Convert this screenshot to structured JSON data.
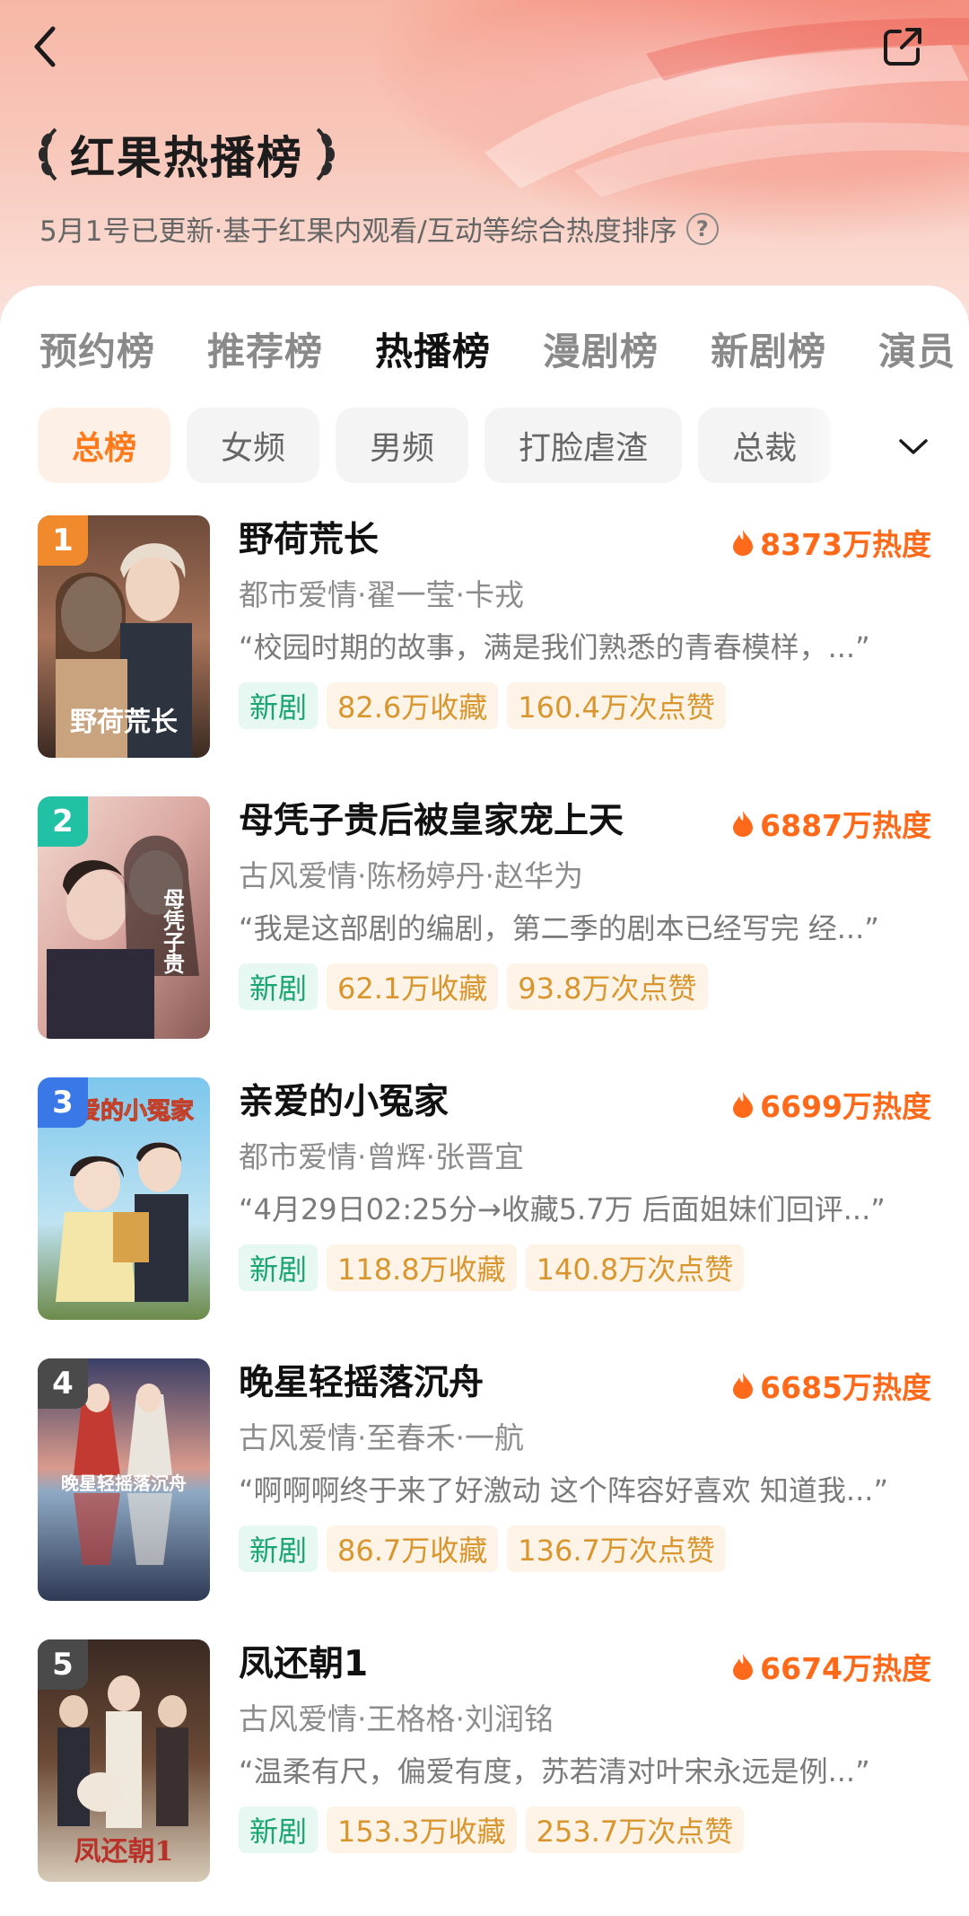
{
  "header": {
    "title": "红果热播榜",
    "subtitle": "5月1号已更新·基于红果内观看/互动等综合热度排序",
    "help_glyph": "?"
  },
  "tabs": [
    {
      "label": "预约榜",
      "active": false
    },
    {
      "label": "推荐榜",
      "active": false
    },
    {
      "label": "热播榜",
      "active": true
    },
    {
      "label": "漫剧榜",
      "active": false
    },
    {
      "label": "新剧榜",
      "active": false
    },
    {
      "label": "演员",
      "active": false
    }
  ],
  "chips": [
    {
      "label": "总榜",
      "active": true
    },
    {
      "label": "女频",
      "active": false
    },
    {
      "label": "男频",
      "active": false
    },
    {
      "label": "打脸虐渣",
      "active": false
    },
    {
      "label": "总裁",
      "active": false
    }
  ],
  "colors": {
    "accent": "#ff7a1a",
    "heat": "#ff6a1a",
    "new_badge_text": "#1aa571",
    "stat_badge_text": "#d9962f",
    "rank1": "#f08a2c",
    "rank2": "#21c1a6",
    "rank3": "#3b78e7",
    "rank_other": "#4a4a4a"
  },
  "items": [
    {
      "rank": "1",
      "title": "野荷荒长",
      "heat": "8373万热度",
      "tags": "都市爱情·翟一莹·卡戎",
      "quote": "“校园时期的故事，满是我们熟悉的青春模样，...”",
      "badge_new": "新剧",
      "favorites": "82.6万收藏",
      "likes": "160.4万次点赞",
      "poster_overlay": "野荷荒长"
    },
    {
      "rank": "2",
      "title": "母凭子贵后被皇家宠上天",
      "heat": "6887万热度",
      "tags": "古风爱情·陈杨婷丹·赵华为",
      "quote": "“我是这部剧的编剧，第二季的剧本已经写完 经...”",
      "badge_new": "新剧",
      "favorites": "62.1万收藏",
      "likes": "93.8万次点赞",
      "poster_overlay": "母凭子贵"
    },
    {
      "rank": "3",
      "title": "亲爱的小冤家",
      "heat": "6699万热度",
      "tags": "都市爱情·曾辉·张晋宜",
      "quote": "“4月29日02:25分→收藏5.7万 后面姐妹们回评...”",
      "badge_new": "新剧",
      "favorites": "118.8万收藏",
      "likes": "140.8万次点赞",
      "poster_overlay": "亲爱的小冤家"
    },
    {
      "rank": "4",
      "title": "晚星轻摇落沉舟",
      "heat": "6685万热度",
      "tags": "古风爱情·至春禾·一航",
      "quote": "“啊啊啊终于来了好激动 这个阵容好喜欢 知道我...”",
      "badge_new": "新剧",
      "favorites": "86.7万收藏",
      "likes": "136.7万次点赞",
      "poster_overlay": "晚星轻摇落沉舟"
    },
    {
      "rank": "5",
      "title": "凤还朝1",
      "heat": "6674万热度",
      "tags": "古风爱情·王格格·刘润铭",
      "quote": "“温柔有尺，偏爱有度，苏若清对叶宋永远是例...”",
      "badge_new": "新剧",
      "favorites": "153.3万收藏",
      "likes": "253.7万次点赞",
      "poster_overlay": "凤还朝1"
    }
  ]
}
